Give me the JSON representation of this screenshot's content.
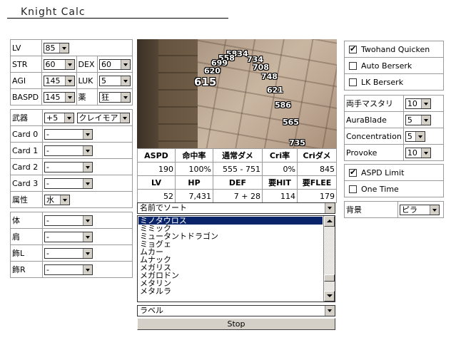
{
  "app": {
    "title": "Knight Calc"
  },
  "left": {
    "rows": [
      {
        "label": "LV",
        "value": "85"
      },
      {
        "label": "STR",
        "value": "60",
        "label2": "DEX",
        "value2": "60"
      },
      {
        "label": "AGI",
        "value": "145",
        "label2": "LUK",
        "value2": "5"
      },
      {
        "label": "BASPD",
        "value": "145",
        "label2": "薬",
        "value2": "狂"
      }
    ],
    "weapon": {
      "label": "武器",
      "refine": "+5",
      "name": "クレイモア"
    },
    "cards": [
      {
        "label": "Card 0",
        "value": "-"
      },
      {
        "label": "Card 1",
        "value": "-"
      },
      {
        "label": "Card 2",
        "value": "-"
      },
      {
        "label": "Card 3",
        "value": "-"
      }
    ],
    "element": {
      "label": "属性",
      "value": "水"
    },
    "equip": [
      {
        "label": "体",
        "value": "-"
      },
      {
        "label": "肩",
        "value": "-"
      },
      {
        "label": "飾L",
        "value": "-"
      },
      {
        "label": "飾R",
        "value": "-"
      }
    ]
  },
  "game": {
    "damage_numbers": [
      "5834",
      "558",
      "699",
      "620",
      "615",
      "734",
      "708",
      "748",
      "621",
      "586",
      "565",
      "735"
    ]
  },
  "stats": {
    "headers1": [
      "ASPD",
      "命中率",
      "通常ダメ",
      "Cri率",
      "Criダメ"
    ],
    "values1": [
      "190",
      "100%",
      "555 - 751",
      "0%",
      "845"
    ],
    "headers2": [
      "LV",
      "HP",
      "DEF",
      "要HIT",
      "要FLEE"
    ],
    "values2": [
      "52",
      "7,431",
      "7 + 28",
      "114",
      "179"
    ]
  },
  "sort_combo": "名前でソート",
  "monster_list": {
    "selected": "ミノタウロス",
    "items": [
      "ミノタウロス",
      "ミミック",
      "ミュータントドラゴン",
      "ミョグェ",
      "ムカー",
      "ムナック",
      "メガリス",
      "メガロドン",
      "メタリン",
      "メタルラ"
    ]
  },
  "label_combo": "ラベル",
  "stop_button": "Stop",
  "right": {
    "checks": [
      {
        "label": "Twohand Quicken",
        "checked": true
      },
      {
        "label": "Auto Berserk",
        "checked": false
      },
      {
        "label": "LK Berserk",
        "checked": false
      }
    ],
    "skills": [
      {
        "label": "両手マスタリ",
        "value": "10"
      },
      {
        "label": "AuraBlade",
        "value": "5"
      },
      {
        "label": "Concentration",
        "value": "5"
      },
      {
        "label": "Provoke",
        "value": "10"
      }
    ],
    "checks2": [
      {
        "label": "ASPD Limit",
        "checked": true
      },
      {
        "label": "One Time",
        "checked": false
      }
    ],
    "background": {
      "label": "背景",
      "value": "ピラ"
    }
  }
}
